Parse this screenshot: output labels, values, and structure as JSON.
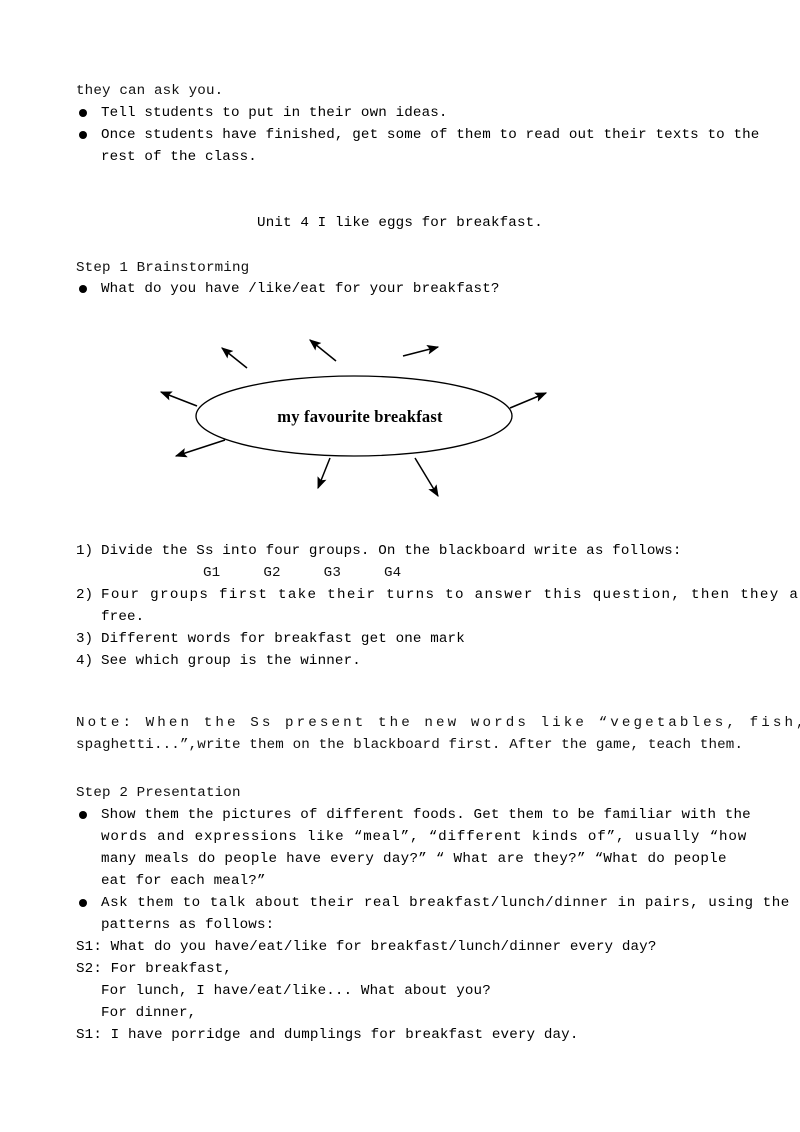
{
  "document": {
    "title": "Unit 4 I like eggs for breakfast.",
    "intro": {
      "continuation_line": "they can ask you.",
      "bullets": [
        "Tell students to put in their own ideas.",
        [
          "Once students have finished, get some of them to read out their texts to the",
          "rest of the class."
        ]
      ]
    },
    "step1": {
      "heading": "Step 1 Brainstorming",
      "prompt_bullet": "What do you have /like/eat for your breakfast?",
      "diagram": {
        "center_label": "my favourite breakfast",
        "arrow_count": 8,
        "stroke_color": "#000000"
      },
      "numbered": [
        {
          "label": "1)",
          "lines": [
            "Divide the Ss into four groups. On the blackboard write as follows:"
          ]
        },
        {
          "label": "2)",
          "lines": [
            "Four groups first take their turns to answer this question, then they are",
            "free."
          ],
          "justify_first_line": true
        },
        {
          "label": "3)",
          "lines": [
            "Different words for breakfast get one mark"
          ]
        },
        {
          "label": "4)",
          "lines": [
            "See which group is the winner."
          ]
        }
      ],
      "groups": [
        "G1",
        "G2",
        "G3",
        "G4"
      ],
      "note": {
        "line1": "Note: When the Ss present the new words like “vegetables, fish,",
        "line2": "spaghetti...”,write them on the blackboard first. After the game, teach them."
      }
    },
    "step2": {
      "heading": "Step 2 Presentation",
      "bullets": [
        [
          "Show them the pictures of different foods. Get them to be familiar with the",
          "words and expressions like “meal”, “different kinds of”, usually “how",
          "many meals do people have every day?” “ What are they?” “What do people",
          "eat for each meal?”"
        ],
        [
          "Ask them to talk about their real breakfast/lunch/dinner in pairs, using the",
          "patterns as follows:"
        ]
      ],
      "dialogue": [
        {
          "speaker": "S1:",
          "text": "S1: What do you have/eat/like for breakfast/lunch/dinner every day?",
          "indent": false
        },
        {
          "speaker": "S2:",
          "text": "S2: For breakfast,",
          "indent": false
        },
        {
          "speaker": "",
          "text": "For lunch, I have/eat/like... What about you?",
          "indent": true
        },
        {
          "speaker": "",
          "text": "For dinner,",
          "indent": true
        },
        {
          "speaker": "S1:",
          "text": "S1: I have porridge and dumplings for breakfast every day.",
          "indent": false
        }
      ]
    }
  }
}
